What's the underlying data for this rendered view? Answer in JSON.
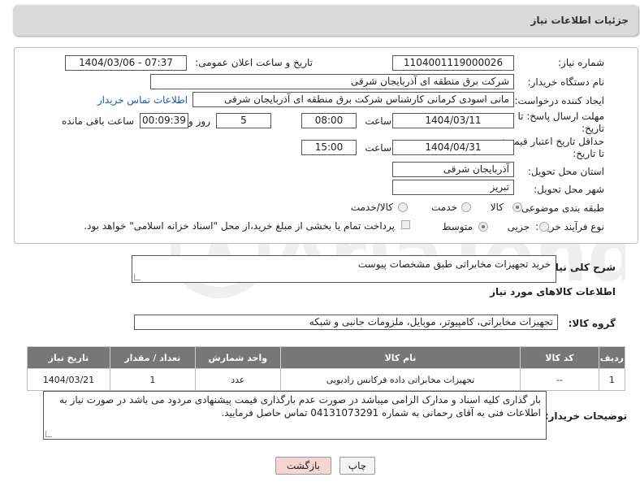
{
  "header": {
    "title": "جزئیات اطلاعات نیاز"
  },
  "form": {
    "need_number": {
      "label": "شماره نیاز:",
      "value": "1104001119000026"
    },
    "announce_datetime": {
      "label": "تاریخ و ساعت اعلان عمومی:",
      "value": "1404/03/06 - 07:37"
    },
    "buyer_org": {
      "label": "نام دستگاه خریدار:",
      "value": "شرکت برق منطقه ای آذربایجان شرقی"
    },
    "requester": {
      "label": "ایجاد کننده درخواست:",
      "value": "مانی اسودی کرمانی کارشناس شرکت برق منطقه ای آذربایجان شرقی",
      "contact_link": "اطلاعات تماس خریدار"
    },
    "deadline": {
      "label_line1": "مهلت ارسال پاسخ: تا",
      "label_line2": "تاریخ:",
      "date": "1404/03/11",
      "time_label": "ساعت",
      "time": "08:00",
      "days": "5",
      "days_label": "روز و",
      "remaining": "00:09:39",
      "remaining_label": "ساعت باقی مانده"
    },
    "price_validity": {
      "label_line1": "حداقل تاریخ اعتبار قیمت:",
      "label_line2": "تا تاریخ:",
      "date": "1404/04/31",
      "time_label": "ساعت",
      "time": "15:00"
    },
    "province": {
      "label": "استان محل تحویل:",
      "value": "آذربایجان شرقی"
    },
    "city": {
      "label": "شهر محل تحویل:",
      "value": "تبریز"
    },
    "category": {
      "label": "طبقه بندی موضوعی:",
      "options": [
        "کالا",
        "خدمت",
        "کالا/خدمت"
      ],
      "selected": "کالا"
    },
    "purchase_type": {
      "label": "نوع فرآیند خرید :",
      "options": [
        "جزیی",
        "متوسط"
      ],
      "selected": "متوسط",
      "note": "پرداخت تمام یا بخشی از مبلغ خرید،از محل \"اسناد خزانه اسلامی\" خواهد بود."
    }
  },
  "description": {
    "label": "شرح کلی نیاز:",
    "value": "خرید تجهیزات مخابراتی طبق مشخصات پیوست"
  },
  "items_section": {
    "title": "اطلاعات کالاهای مورد نیاز",
    "group_label": "گروه کالا:",
    "group_value": "تجهیزات مخابراتی، کامپیوتر، موبایل، ملزومات جانبی و شبکه",
    "columns": [
      "ردیف",
      "کد کالا",
      "نام کالا",
      "واحد شمارش",
      "تعداد / مقدار",
      "تاریخ نیاز"
    ],
    "rows": [
      {
        "row": "1",
        "code": "--",
        "name": "تجهیزات مخابراتی داده فرکانس رادیویی",
        "unit": "عدد",
        "qty": "1",
        "date": "1404/03/21"
      }
    ]
  },
  "buyer_notes": {
    "label": "توضیحات خریدار:",
    "value": "بار گذاری کلیه اسناد و مدارک الزامی میباشد در صورت عدم بارگذاری قیمت پیشنهادی مردود می باشد در صورت نیاز به اطلاعات فنی به آقای رحمانی به شماره 04131073291 تماس حاصل فرمایید."
  },
  "buttons": {
    "print": "چاپ",
    "back": "بازگشت"
  },
  "colors": {
    "header_bg": "#d9d9d9",
    "table_header_bg": "#777777",
    "link": "#1a5bb5",
    "back_button_bg": "#f6d5d5"
  }
}
